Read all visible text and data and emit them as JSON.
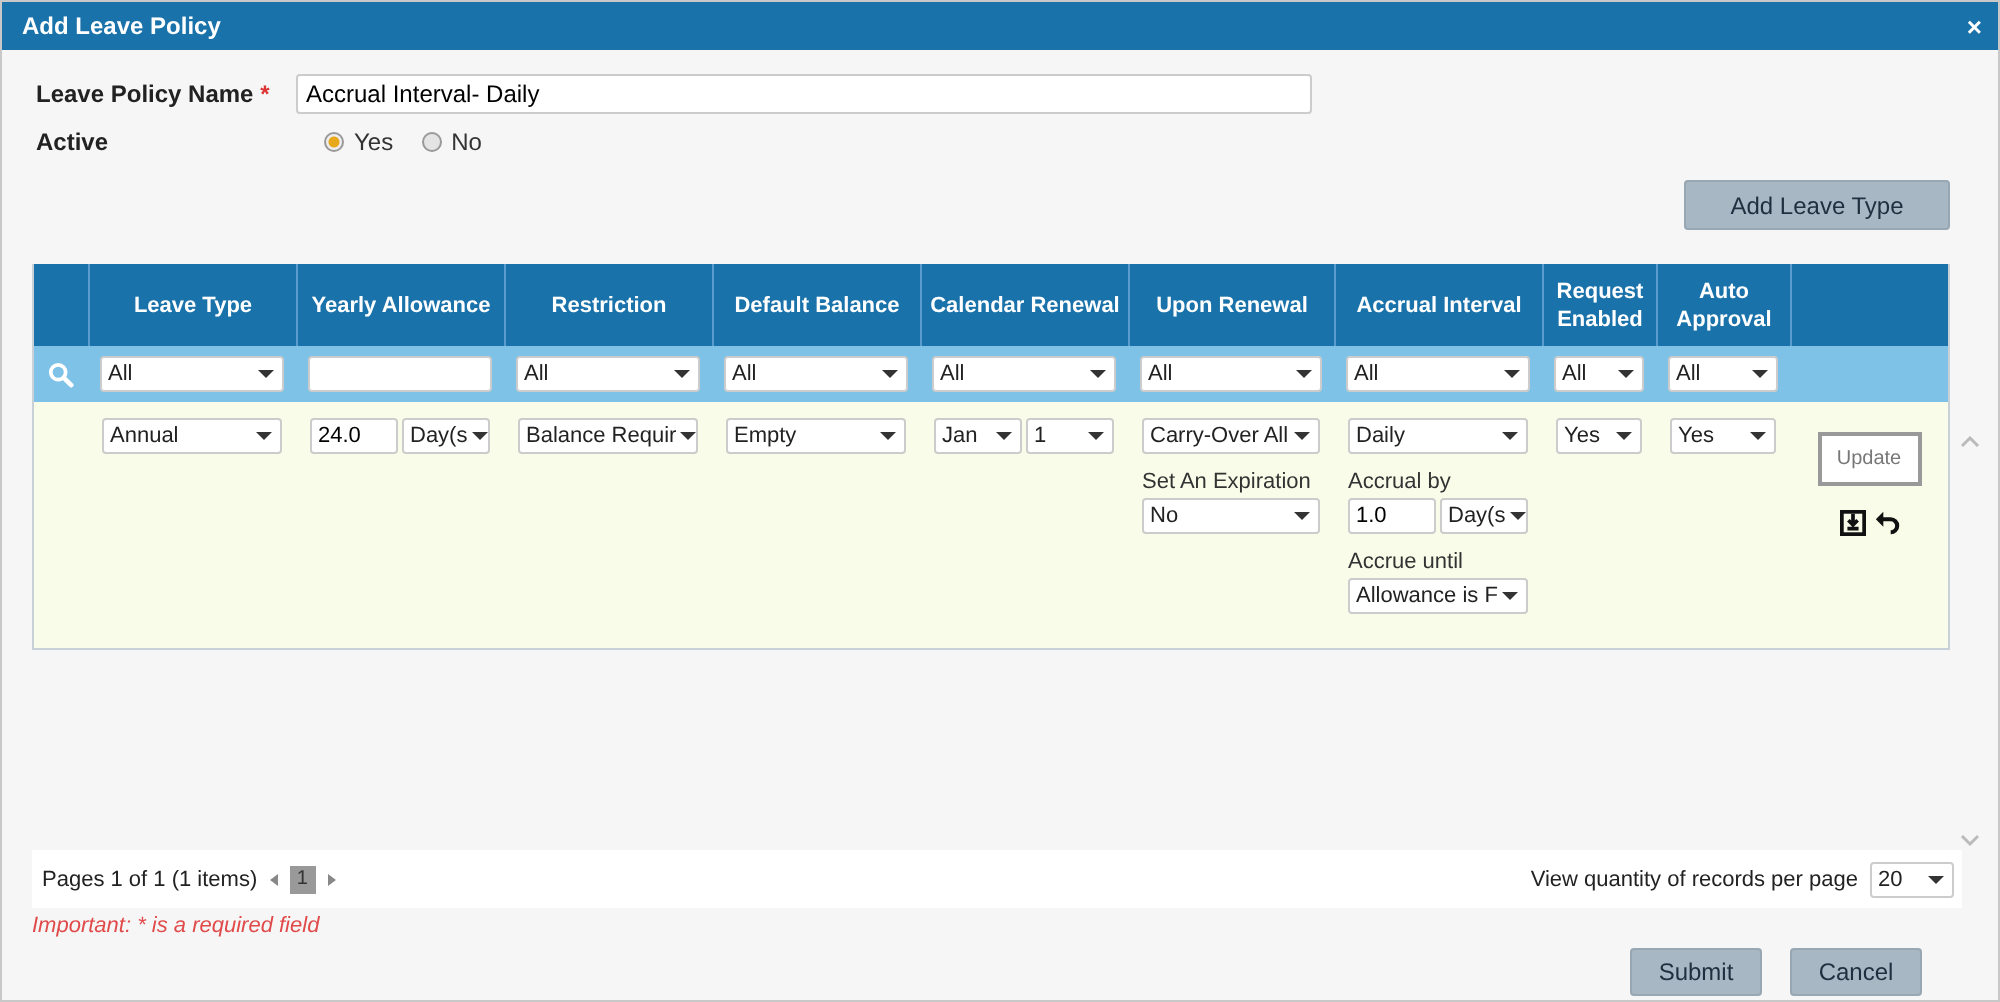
{
  "window": {
    "title": "Add Leave Policy",
    "close": "×"
  },
  "form": {
    "name_label": "Leave Policy Name",
    "required_mark": "*",
    "name_value": "Accrual Interval- Daily",
    "active_label": "Active",
    "active_options": [
      {
        "label": "Yes",
        "selected": true
      },
      {
        "label": "No",
        "selected": false
      }
    ]
  },
  "add_button": "Add Leave Type",
  "table": {
    "columns": [
      "Leave Type",
      "Yearly Allowance",
      "Restriction",
      "Default Balance",
      "Calendar Renewal",
      "Upon Renewal",
      "Accrual Interval",
      "Request Enabled",
      "Auto Approval"
    ],
    "filters": [
      {
        "kind": "select",
        "value": "All"
      },
      {
        "kind": "input"
      },
      {
        "kind": "select",
        "value": "All"
      },
      {
        "kind": "select",
        "value": "All"
      },
      {
        "kind": "select",
        "value": "All"
      },
      {
        "kind": "select",
        "value": "All"
      },
      {
        "kind": "select",
        "value": "All"
      },
      {
        "kind": "select",
        "value": "All"
      },
      {
        "kind": "select",
        "value": "All"
      }
    ],
    "row": {
      "cells": [
        [
          [
            {
              "kind": "select",
              "value": "Annual"
            }
          ]
        ],
        [
          [
            {
              "kind": "input",
              "value": "24.0"
            },
            {
              "kind": "select",
              "value": "Day(s"
            }
          ]
        ],
        [
          [
            {
              "kind": "select",
              "value": "Balance Requir"
            }
          ]
        ],
        [
          [
            {
              "kind": "select",
              "value": "Empty"
            }
          ]
        ],
        [
          [
            {
              "kind": "select",
              "value": "Jan"
            },
            {
              "kind": "select",
              "value": "1"
            }
          ]
        ],
        [
          [
            {
              "kind": "select",
              "value": "Carry-Over All"
            }
          ],
          [
            {
              "kind": "label",
              "value": "Set An Expiration"
            }
          ],
          [
            {
              "kind": "select",
              "value": "No"
            }
          ]
        ],
        [
          [
            {
              "kind": "select",
              "value": "Daily"
            }
          ],
          [
            {
              "kind": "label",
              "value": "Accrual by"
            }
          ],
          [
            {
              "kind": "input",
              "value": "1.0"
            },
            {
              "kind": "select",
              "value": "Day(s"
            }
          ],
          [
            {
              "kind": "label",
              "value": "Accrue until"
            }
          ],
          [
            {
              "kind": "select",
              "value": "Allowance is F"
            }
          ]
        ],
        [
          [
            {
              "kind": "select",
              "value": "Yes"
            }
          ]
        ],
        [
          [
            {
              "kind": "select",
              "value": "Yes"
            }
          ]
        ]
      ],
      "update_button": "Update"
    }
  },
  "pager": {
    "summary": "Pages 1 of 1 (1 items)",
    "pages": [
      {
        "label": "1",
        "selected": true
      }
    ],
    "per_page_label": "View quantity of records per page",
    "per_page": "20"
  },
  "note": "Important: * is a required field",
  "buttons": [
    "Submit",
    "Cancel"
  ]
}
